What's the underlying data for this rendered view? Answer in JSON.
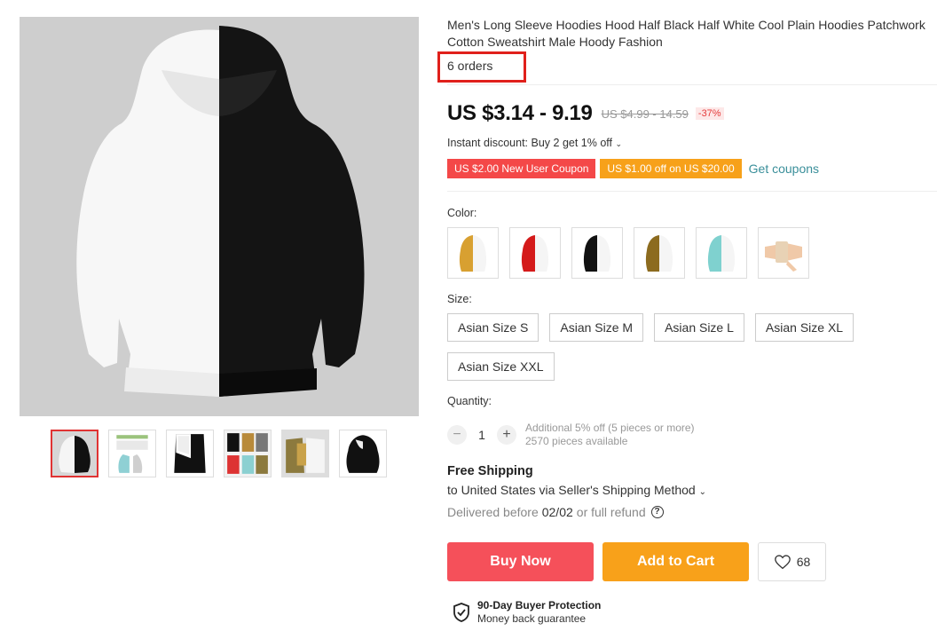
{
  "product": {
    "title": "Men's Long Sleeve Hoodies Hood Half Black Half White Cool Plain Hoodies Patchwork Cotton Sweatshirt Male Hoody Fashion",
    "orders": "6 orders"
  },
  "price": {
    "current": "US $3.14 - 9.19",
    "original": "US $4.99 - 14.59",
    "discount": "-37%"
  },
  "promo": {
    "instant_discount": "Instant discount: Buy 2 get 1% off",
    "coupon_new_user": "US $2.00 New User Coupon",
    "coupon_store": "US $1.00 off on US $20.00",
    "get_coupons": "Get coupons"
  },
  "color": {
    "label": "Color:",
    "options": [
      "khaki-white",
      "red-white",
      "black-white",
      "olive-white",
      "aqua-white",
      "beige-wristband"
    ]
  },
  "size": {
    "label": "Size:",
    "options": [
      "Asian Size S",
      "Asian Size M",
      "Asian Size L",
      "Asian Size XL",
      "Asian Size XXL"
    ]
  },
  "quantity": {
    "label": "Quantity:",
    "minus": "−",
    "value": "1",
    "plus": "+",
    "note_discount": "Additional 5% off (5 pieces or more)",
    "note_available": "2570 pieces available"
  },
  "shipping": {
    "title": "Free Shipping",
    "method": "to United States via Seller's Shipping Method",
    "delivered_prefix": "Delivered before",
    "delivered_date": "02/02",
    "delivered_suffix": "or full refund",
    "help": "?"
  },
  "actions": {
    "buy_now": "Buy Now",
    "add_to_cart": "Add to Cart",
    "wishlist_count": "68"
  },
  "protection": {
    "title": "90-Day Buyer Protection",
    "subtitle": "Money back guarantee"
  },
  "colors": {
    "accent_red": "#f5505a",
    "accent_orange": "#f8a11a",
    "highlight_box": "#e0201b",
    "link_teal": "#3a8f9a"
  }
}
